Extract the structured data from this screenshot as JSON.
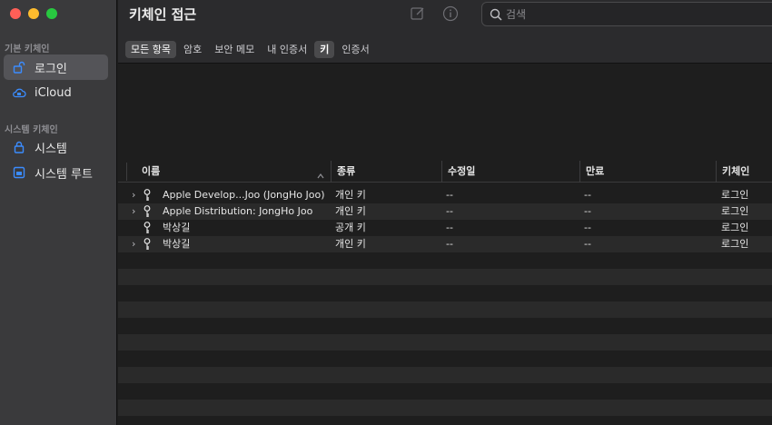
{
  "app": {
    "title": "키체인 접근"
  },
  "sidebar": {
    "default_section": "기본 키체인",
    "system_section": "시스템 키체인",
    "items": [
      {
        "label": "로그인",
        "icon": "unlock-icon",
        "selected": true
      },
      {
        "label": "iCloud",
        "icon": "cloud-icon",
        "selected": false
      },
      {
        "label": "시스템",
        "icon": "lock-icon",
        "selected": false
      },
      {
        "label": "시스템 루트",
        "icon": "cabinet-icon",
        "selected": false
      }
    ]
  },
  "toolbar": {
    "search_placeholder": "검색"
  },
  "filters": [
    {
      "label": "모든 항목",
      "active": true
    },
    {
      "label": "암호",
      "active": false
    },
    {
      "label": "보안 메모",
      "active": false
    },
    {
      "label": "내 인증서",
      "active": false
    },
    {
      "label": "키",
      "active": true
    },
    {
      "label": "인증서",
      "active": false
    }
  ],
  "table": {
    "columns": [
      "이름",
      "종류",
      "수정일",
      "만료",
      "키체인"
    ],
    "rows": [
      {
        "expandable": true,
        "name": "Apple Develop...Joo (JongHo Joo)",
        "kind": "개인 키",
        "modified": "--",
        "expires": "--",
        "keychain": "로그인"
      },
      {
        "expandable": true,
        "name": "Apple Distribution: JongHo Joo",
        "kind": "개인 키",
        "modified": "--",
        "expires": "--",
        "keychain": "로그인"
      },
      {
        "expandable": false,
        "name": "박상길",
        "kind": "공개 키",
        "modified": "--",
        "expires": "--",
        "keychain": "로그인"
      },
      {
        "expandable": true,
        "name": "박상길",
        "kind": "개인 키",
        "modified": "--",
        "expires": "--",
        "keychain": "로그인"
      }
    ],
    "disclosure_glyph": "›"
  },
  "colors": {
    "accent": "#3b8cff",
    "selection": "#545458",
    "sidebar": "#3a3a3c"
  }
}
